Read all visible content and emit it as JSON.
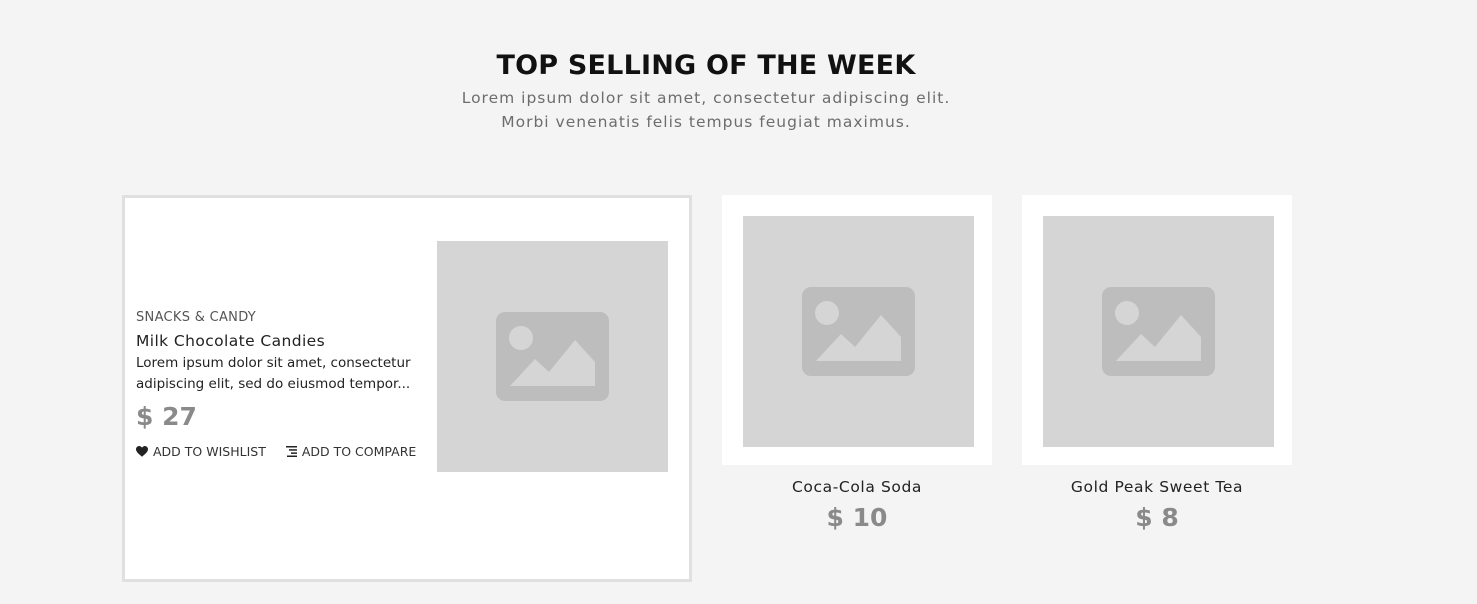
{
  "section": {
    "title": "TOP SELLING OF THE WEEK",
    "subtitle_line1": "Lorem ipsum dolor sit amet, consectetur adipiscing elit.",
    "subtitle_line2": "Morbi venenatis felis tempus feugiat maximus."
  },
  "featured": {
    "category": "SNACKS & CANDY",
    "name": "Milk Chocolate Candies",
    "description_line1": "Lorem ipsum dolor sit amet, consectetur",
    "description_line2": "adipiscing elit, sed do eiusmod tempor...",
    "price": "$ 27",
    "wishlist_label": "ADD TO WISHLIST",
    "compare_label": "ADD TO COMPARE",
    "image_icon": "image-placeholder-icon"
  },
  "products": [
    {
      "name": "Coca-Cola Soda",
      "price": "$ 10",
      "image_icon": "image-placeholder-icon"
    },
    {
      "name": "Gold Peak Sweet Tea",
      "price": "$ 8",
      "image_icon": "image-placeholder-icon"
    }
  ],
  "colors": {
    "background": "#f4f4f4",
    "card_background": "#ffffff",
    "placeholder": "#d5d5d5",
    "placeholder_icon": "#bdbdbd",
    "price": "#8a8a8a",
    "featured_border": "#e0e0e0"
  },
  "icons": {
    "wishlist": "heart-icon",
    "compare": "compare-list-icon"
  }
}
